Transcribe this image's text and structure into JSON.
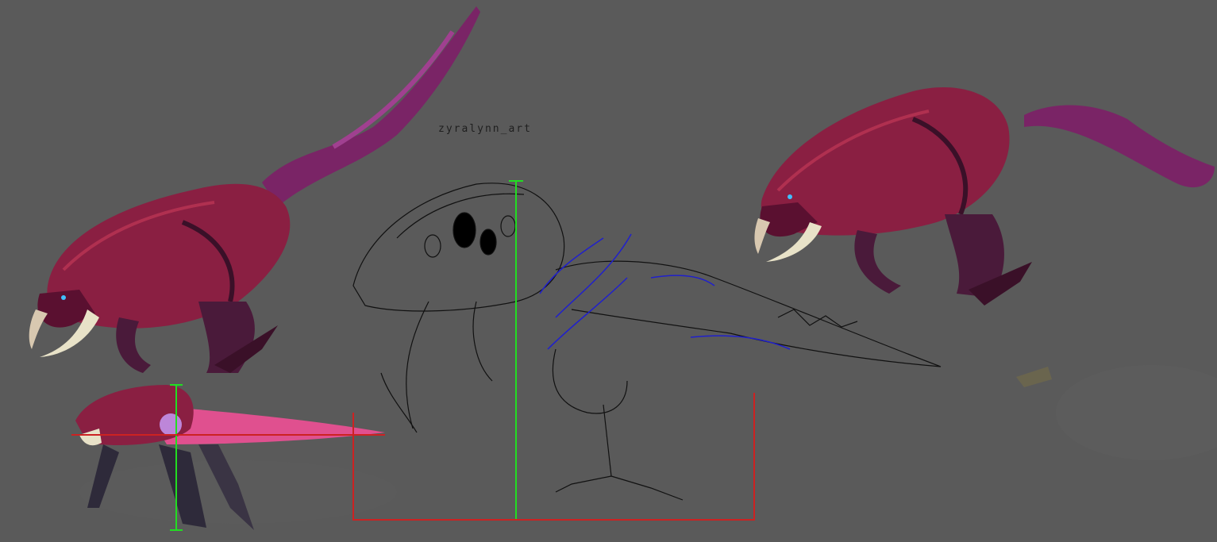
{
  "watermark": {
    "text": "zyralynn_art"
  },
  "palette": {
    "background": "#5a5a5a",
    "creature_body": "#7a1e3c",
    "creature_shadow": "#3a1028",
    "creature_limbs": "#4a1a3a",
    "spine_pink": "#e0508f",
    "tusk": "#e8e2c8",
    "lineart": "#111111",
    "fin_lines": "#2020cc",
    "measure_green": "#22dd22",
    "measure_red": "#cc2222"
  },
  "icons": [
    "creature-painting",
    "creature-lineart",
    "creature-thumbnail",
    "height-guide",
    "baseline-guide"
  ]
}
